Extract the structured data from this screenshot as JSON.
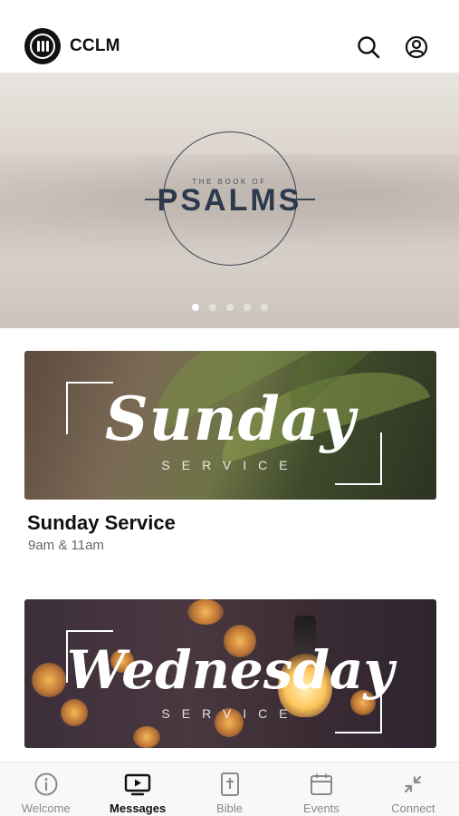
{
  "header": {
    "app_title": "CCLM",
    "logo_icon": "cclm-logo-icon",
    "search_icon": "search-icon",
    "profile_icon": "profile-icon"
  },
  "hero": {
    "kicker": "THE BOOK OF",
    "title": "PSALMS",
    "carousel": {
      "total_pages": 5,
      "current_page": 1
    }
  },
  "cards": [
    {
      "image_script": "Sunday",
      "image_subtitle": "SERVICE",
      "title": "Sunday Service",
      "subtitle": "9am & 11am"
    },
    {
      "image_script": "Wednesday",
      "image_subtitle": "SERVICE"
    }
  ],
  "tabbar": {
    "active": "Messages",
    "tabs": [
      {
        "label": "Welcome",
        "icon": "info-icon"
      },
      {
        "label": "Messages",
        "icon": "tv-play-icon"
      },
      {
        "label": "Bible",
        "icon": "bible-icon"
      },
      {
        "label": "Events",
        "icon": "calendar-icon"
      },
      {
        "label": "Connect",
        "icon": "connect-arrows-icon"
      }
    ]
  },
  "colors": {
    "text_primary": "#111111",
    "text_secondary": "#666666",
    "tab_inactive": "#8a8a8a",
    "psalms_title": "#2d3a4e"
  }
}
